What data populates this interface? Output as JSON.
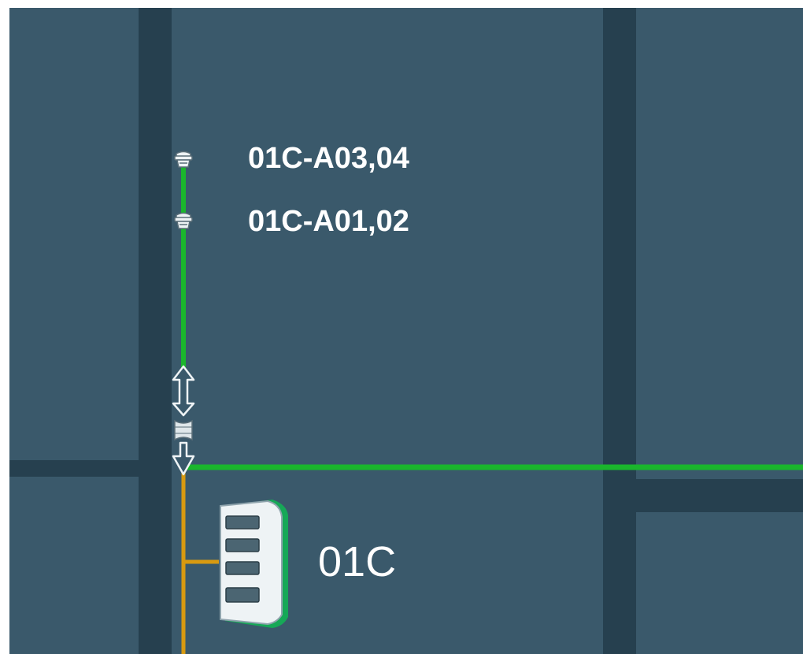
{
  "colors": {
    "block": "#3a596b",
    "road": "#26404f",
    "fiber_line": "#1ab62c",
    "copper_line": "#d89a10",
    "icon_fill": "#eef3f5",
    "icon_stroke": "#5a6e78",
    "cabinet_accent": "#16a857",
    "label": "#ffffff"
  },
  "map": {
    "terminals": [
      {
        "id": "01C-A03,04",
        "icon": "pedestal-terminal-icon"
      },
      {
        "id": "01C-A01,02",
        "icon": "pedestal-terminal-icon"
      }
    ],
    "splice": {
      "icon": "splice-closure-icon",
      "arrows": [
        "bidirectional-arrow-icon",
        "down-arrow-icon"
      ]
    },
    "cabinet": {
      "id": "01C",
      "icon": "cabinet-icon"
    }
  }
}
